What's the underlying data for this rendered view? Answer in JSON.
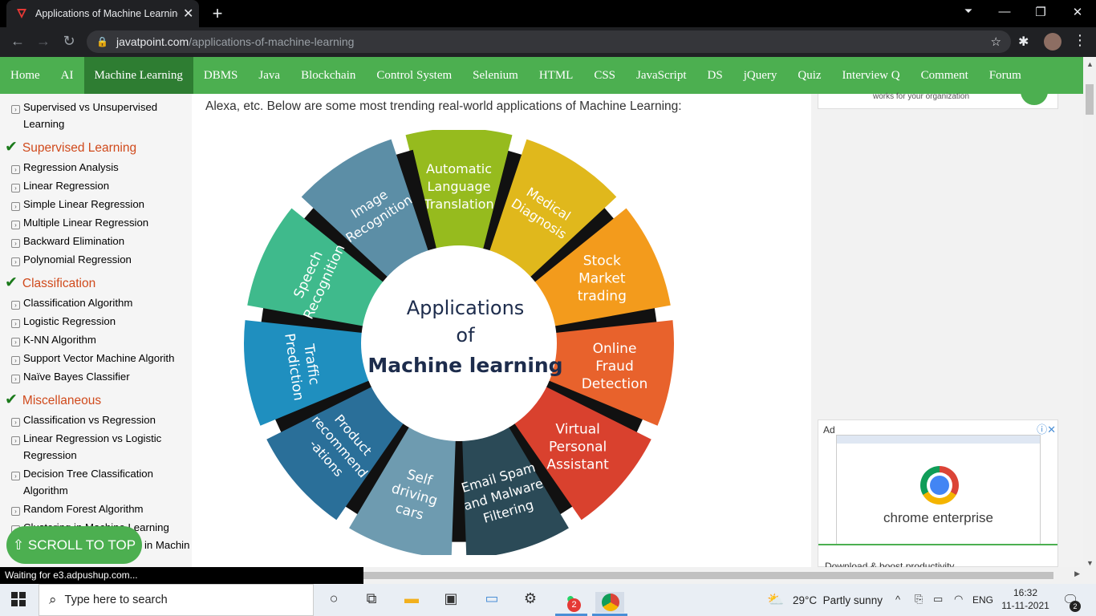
{
  "browser": {
    "tab_title": "Applications of Machine Learning",
    "url_host": "javatpoint.com",
    "url_path": "/applications-of-machine-learning"
  },
  "site_nav": [
    "Home",
    "AI",
    "Machine Learning",
    "DBMS",
    "Java",
    "Blockchain",
    "Control System",
    "Selenium",
    "HTML",
    "CSS",
    "JavaScript",
    "DS",
    "jQuery",
    "Quiz",
    "Interview Q",
    "Comment",
    "Forum"
  ],
  "sidebar": {
    "items": [
      {
        "type": "link",
        "label": "Supervised vs Unsupervised"
      },
      {
        "type": "cont",
        "label": "Learning"
      },
      {
        "type": "head",
        "label": "Supervised Learning"
      },
      {
        "type": "link",
        "label": "Regression Analysis"
      },
      {
        "type": "link",
        "label": "Linear Regression"
      },
      {
        "type": "link",
        "label": "Simple Linear Regression"
      },
      {
        "type": "link",
        "label": "Multiple Linear Regression"
      },
      {
        "type": "link",
        "label": "Backward Elimination"
      },
      {
        "type": "link",
        "label": "Polynomial Regression"
      },
      {
        "type": "head",
        "label": "Classification"
      },
      {
        "type": "link",
        "label": "Classification Algorithm"
      },
      {
        "type": "link",
        "label": "Logistic Regression"
      },
      {
        "type": "link",
        "label": "K-NN Algorithm"
      },
      {
        "type": "link",
        "label": "Support Vector Machine Algorith"
      },
      {
        "type": "link",
        "label": "Naïve Bayes Classifier"
      },
      {
        "type": "head",
        "label": "Miscellaneous"
      },
      {
        "type": "link",
        "label": "Classification vs Regression"
      },
      {
        "type": "link",
        "label": "Linear Regression vs Logistic"
      },
      {
        "type": "cont",
        "label": "Regression"
      },
      {
        "type": "link",
        "label": "Decision Tree Classification"
      },
      {
        "type": "cont",
        "label": "Algorithm"
      },
      {
        "type": "link",
        "label": "Random Forest Algorithm"
      },
      {
        "type": "link",
        "label": "Clustering in Machine Learning"
      }
    ],
    "scroll_to_top": "⇧ SCROLL TO TOP",
    "hidden_tail": "in Machin"
  },
  "main": {
    "intro": "Alexa, etc. Below are some most trending real-world applications of Machine Learning:",
    "wheel": {
      "center_lines": [
        "Applications",
        "of",
        "Machine learning"
      ],
      "segments": [
        {
          "lines": [
            "Automatic",
            "Language",
            "Translation"
          ],
          "color": "#96bb1e"
        },
        {
          "lines": [
            "Medical",
            "Diagnosis"
          ],
          "color": "#e0b81c"
        },
        {
          "lines": [
            "Stock",
            "Market",
            "trading"
          ],
          "color": "#f39b1c"
        },
        {
          "lines": [
            "Online",
            "Fraud",
            "Detection"
          ],
          "color": "#e8622c"
        },
        {
          "lines": [
            "Virtual",
            "Personal",
            "Assistant"
          ],
          "color": "#d9412e"
        },
        {
          "lines": [
            "Email Spam",
            "and Malware",
            "Filtering"
          ],
          "color": "#2b4a57"
        },
        {
          "lines": [
            "Self",
            "driving",
            "cars"
          ],
          "color": "#6e9bb0"
        },
        {
          "lines": [
            "Product",
            "recommend",
            "-ations"
          ],
          "color": "#2a6f99"
        },
        {
          "lines": [
            "Traffic",
            "Prediction"
          ],
          "color": "#1f8fbf"
        },
        {
          "lines": [
            "Speech",
            "Recognition"
          ],
          "color": "#3fba8c"
        },
        {
          "lines": [
            "Image",
            "Recognition"
          ],
          "color": "#5c8ea6"
        }
      ]
    }
  },
  "ads": {
    "top_text": "works for your organization",
    "ad_label": "Ad",
    "brand": "chrome enterprise",
    "cta": "Download & boost productivity"
  },
  "status_text": "Waiting for e3.adpushup.com...",
  "taskbar": {
    "search_placeholder": "Type here to search",
    "whatsapp_badge": "2",
    "weather": "29°C  Partly sunny",
    "lang": "ENG",
    "time": "16:32",
    "date": "11-11-2021",
    "notif_count": "2"
  }
}
